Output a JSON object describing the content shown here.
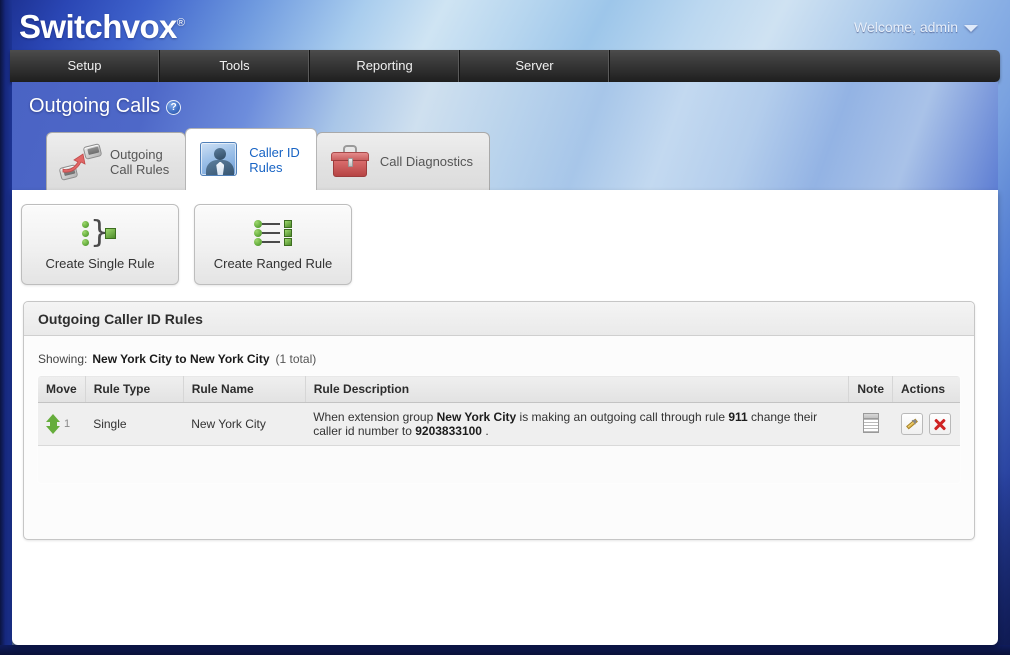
{
  "header": {
    "logo": "Switchvox",
    "logo_reg": "®",
    "welcome": "Welcome, admin",
    "caret_icon": "chevron-down-icon"
  },
  "nav": {
    "items": [
      {
        "label": "Setup"
      },
      {
        "label": "Tools"
      },
      {
        "label": "Reporting"
      },
      {
        "label": "Server"
      }
    ]
  },
  "page": {
    "title": "Outgoing Calls",
    "help_glyph": "?",
    "help_icon": "help-icon"
  },
  "tabs": [
    {
      "label": "Outgoing\nCall Rules",
      "icon": "outgoing-call-rules-icon",
      "active": false
    },
    {
      "label": "Caller ID\nRules",
      "icon": "caller-id-rules-icon",
      "active": true
    },
    {
      "label": "Call Diagnostics",
      "icon": "call-diagnostics-icon",
      "active": false
    }
  ],
  "buttons": [
    {
      "label": "Create Single Rule",
      "icon": "single-rule-icon"
    },
    {
      "label": "Create Ranged Rule",
      "icon": "ranged-rule-icon"
    }
  ],
  "panel": {
    "title": "Outgoing Caller ID Rules",
    "showing_label": "Showing:",
    "showing_value": "New York City to New York City",
    "showing_count": "(1 total)"
  },
  "table": {
    "columns": [
      {
        "key": "move",
        "label": "Move"
      },
      {
        "key": "type",
        "label": "Rule Type"
      },
      {
        "key": "name",
        "label": "Rule Name"
      },
      {
        "key": "desc",
        "label": "Rule Description"
      },
      {
        "key": "note",
        "label": "Note"
      },
      {
        "key": "actions",
        "label": "Actions"
      }
    ],
    "rows": [
      {
        "move_order": "1",
        "move_icon": "move-up-down-icon",
        "type": "Single",
        "name": "New York City",
        "desc_part1": "When extension group ",
        "desc_group": "New York City",
        "desc_part2": " is making an outgoing call through rule ",
        "desc_rule": "911",
        "desc_part3": " change their caller id number to ",
        "desc_number": "9203833100",
        "desc_part4": " .",
        "note_icon": "note-icon",
        "edit_icon": "edit-pencil-icon",
        "delete_icon": "delete-x-icon"
      }
    ]
  },
  "colors": {
    "accent_blue": "#1763c4",
    "brand_dark_blue": "#16287e",
    "green": "#66ad3c",
    "red": "#cf2222"
  }
}
